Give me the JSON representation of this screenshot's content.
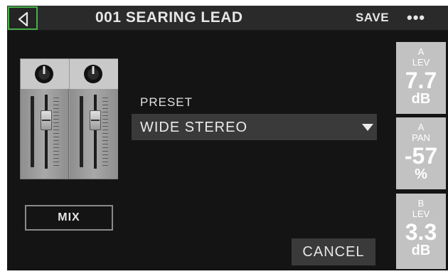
{
  "header": {
    "back_icon": "chevron-left-icon",
    "title": "001 SEARING LEAD",
    "save_label": "SAVE",
    "more_label": "•••"
  },
  "mixer": {
    "icon": "mixer-strip-icon"
  },
  "mix_button": {
    "label": "MIX"
  },
  "preset": {
    "label": "PRESET",
    "value": "WIDE STEREO",
    "caret_icon": "caret-down-icon"
  },
  "cancel_button": {
    "label": "CANCEL"
  },
  "params": [
    {
      "line1": "A",
      "line2": "LEV",
      "value": "7.7",
      "unit": "dB"
    },
    {
      "line1": "A",
      "line2": "PAN",
      "value": "-57",
      "unit": "%"
    },
    {
      "line1": "B",
      "line2": "LEV",
      "value": "3.3",
      "unit": "dB"
    }
  ],
  "colors": {
    "accent": "#48b04a",
    "background": "#141414",
    "param_tile": "#c2c2c2"
  }
}
